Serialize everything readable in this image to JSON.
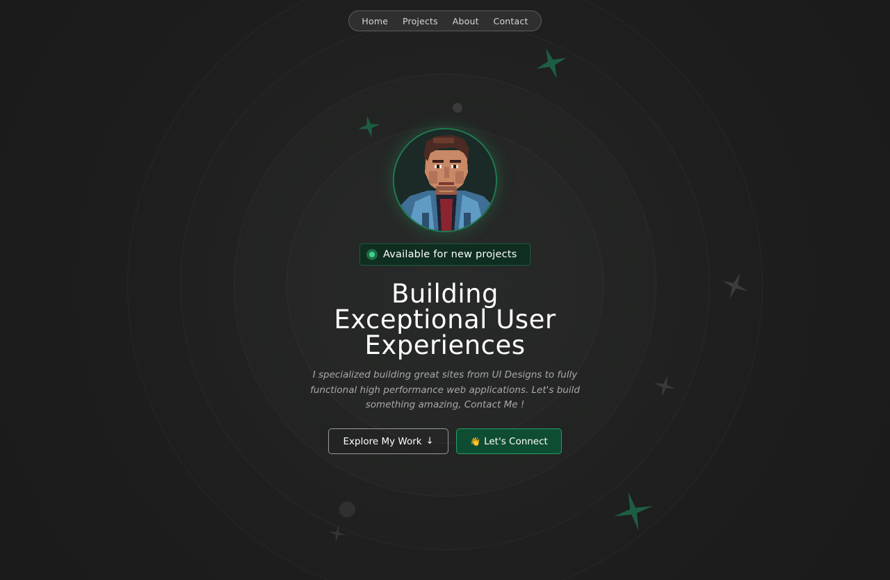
{
  "nav": {
    "items": [
      {
        "label": "Home"
      },
      {
        "label": "Projects"
      },
      {
        "label": "About"
      },
      {
        "label": "Contact"
      }
    ]
  },
  "hero": {
    "avatar_icon": "pixel-art-portrait",
    "badge": "Available for new projects",
    "headline": [
      "Building",
      "Exceptional User",
      "Experiences"
    ],
    "subtitle": "I specialized building great sites from UI Designs to fully functional high performance web applications. Let's build something amazing, Contact Me !",
    "buttons": {
      "explore": {
        "label": "Explore My Work",
        "icon": "↓"
      },
      "connect": {
        "label": "Let's Connect",
        "icon": "👋"
      }
    }
  },
  "colors": {
    "background": "#1c1c1c",
    "accent": "#1f7a52",
    "accent_bright": "#3fd48a",
    "connect_bg": "#0f4d33"
  }
}
